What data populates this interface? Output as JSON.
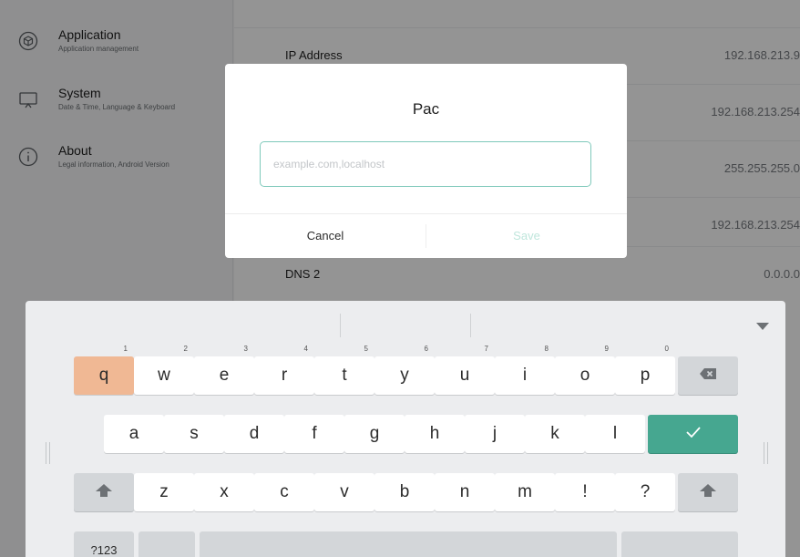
{
  "sidebar": {
    "items": [
      {
        "title": "Application",
        "subtitle": "Application management",
        "icon": "cube-icon"
      },
      {
        "title": "System",
        "subtitle": "Date & Time, Language & Keyboard",
        "icon": "monitor-icon"
      },
      {
        "title": "About",
        "subtitle": "Legal information, Android Version",
        "icon": "info-icon"
      }
    ]
  },
  "network": {
    "rows": [
      {
        "label": "IP Address",
        "value": "192.168.213.9"
      },
      {
        "label": "",
        "value": "192.168.213.254"
      },
      {
        "label": "",
        "value": "255.255.255.0"
      },
      {
        "label": "",
        "value": "192.168.213.254"
      },
      {
        "label": "DNS 2",
        "value": "0.0.0.0"
      }
    ]
  },
  "dialog": {
    "title": "Pac",
    "input_value": "",
    "input_placeholder": "example.com,localhost",
    "cancel_label": "Cancel",
    "save_label": "Save"
  },
  "keyboard": {
    "row1": [
      {
        "key": "q",
        "hint": "1"
      },
      {
        "key": "w",
        "hint": "2"
      },
      {
        "key": "e",
        "hint": "3"
      },
      {
        "key": "r",
        "hint": "4"
      },
      {
        "key": "t",
        "hint": "5"
      },
      {
        "key": "y",
        "hint": "6"
      },
      {
        "key": "u",
        "hint": "7"
      },
      {
        "key": "i",
        "hint": "8"
      },
      {
        "key": "o",
        "hint": "9"
      },
      {
        "key": "p",
        "hint": "0"
      }
    ],
    "row2": [
      "a",
      "s",
      "d",
      "f",
      "g",
      "h",
      "j",
      "k",
      "l"
    ],
    "row3": [
      "z",
      "x",
      "c",
      "v",
      "b",
      "n",
      "m",
      "!",
      "?"
    ],
    "symbols_label": "?123",
    "pressed_key": "q"
  },
  "colors": {
    "accent": "#46a790",
    "input_border": "#7fc9bb",
    "pressed_key": "#f0b894",
    "save_disabled": "#bfe6dc"
  }
}
